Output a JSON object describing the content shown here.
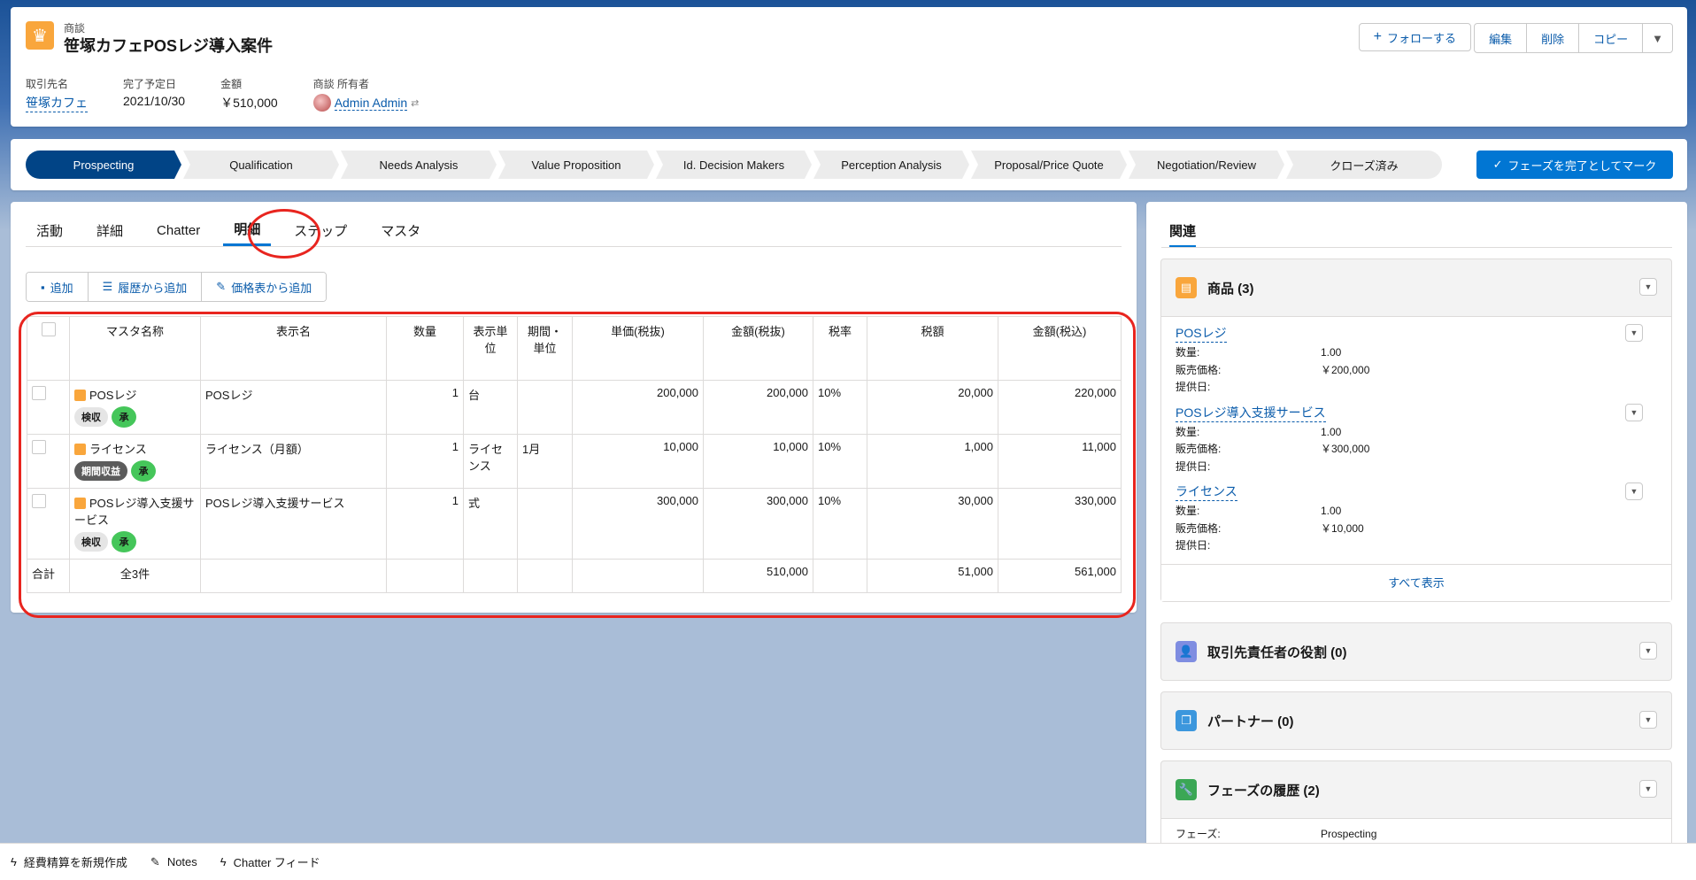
{
  "header": {
    "object_type": "商談",
    "title": "笹塚カフェPOSレジ導入案件",
    "follow_label": "フォローする",
    "actions": [
      "編集",
      "削除",
      "コピー"
    ],
    "fields": [
      {
        "label": "取引先名",
        "value": "笹塚カフェ"
      },
      {
        "label": "完了予定日",
        "value": "2021/10/30"
      },
      {
        "label": "金額",
        "value": "￥510,000"
      },
      {
        "label": "商談 所有者",
        "value": "Admin Admin"
      }
    ]
  },
  "path": {
    "stages": [
      "Prospecting",
      "Qualification",
      "Needs Analysis",
      "Value Proposition",
      "Id. Decision Makers",
      "Perception Analysis",
      "Proposal/Price Quote",
      "Negotiation/Review",
      "クローズ済み"
    ],
    "active_index": 0,
    "mark_button": "フェーズを完了としてマーク"
  },
  "tabs": [
    "活動",
    "詳細",
    "Chatter",
    "明細",
    "ステップ",
    "マスタ"
  ],
  "active_tab": "明細",
  "line_buttons": [
    "追加",
    "履歴から追加",
    "価格表から追加"
  ],
  "table": {
    "headers": [
      "マスタ名称",
      "表示名",
      "数量",
      "表示単位",
      "期間・単位",
      "単価(税抜)",
      "金額(税抜)",
      "税率",
      "税額",
      "金額(税込)"
    ],
    "rows": [
      {
        "master": "POSレジ",
        "badge1": "検収",
        "badge2": "承",
        "display": "POSレジ",
        "qty": "1",
        "unit": "台",
        "period": "",
        "price": "200,000",
        "amount": "200,000",
        "rate": "10%",
        "tax": "20,000",
        "total": "220,000"
      },
      {
        "master": "ライセンス",
        "badge1": "期間収益",
        "badge2": "承",
        "display": "ライセンス（月額）",
        "qty": "1",
        "unit": "ライセンス",
        "period": "1月",
        "price": "10,000",
        "amount": "10,000",
        "rate": "10%",
        "tax": "1,000",
        "total": "11,000"
      },
      {
        "master": "POSレジ導入支援サービス",
        "badge1": "検収",
        "badge2": "承",
        "display": "POSレジ導入支援サービス",
        "qty": "1",
        "unit": "式",
        "period": "",
        "price": "300,000",
        "amount": "300,000",
        "rate": "10%",
        "tax": "30,000",
        "total": "330,000"
      }
    ],
    "footer": {
      "label": "合計",
      "count": "全3件",
      "amount": "510,000",
      "tax": "51,000",
      "total": "561,000"
    }
  },
  "related": {
    "title": "関連",
    "products": {
      "heading": "商品 (3)",
      "items": [
        {
          "name": "POSレジ",
          "qty_label": "数量:",
          "qty": "1.00",
          "price_label": "販売価格:",
          "price": "￥200,000",
          "date_label": "提供日:"
        },
        {
          "name": "POSレジ導入支援サービス",
          "qty_label": "数量:",
          "qty": "1.00",
          "price_label": "販売価格:",
          "price": "￥300,000",
          "date_label": "提供日:"
        },
        {
          "name": "ライセンス",
          "qty_label": "数量:",
          "qty": "1.00",
          "price_label": "販売価格:",
          "price": "￥10,000",
          "date_label": "提供日:"
        }
      ],
      "show_all": "すべて表示"
    },
    "contact_roles": "取引先責任者の役割 (0)",
    "partners": "パートナー (0)",
    "stage_history": {
      "heading": "フェーズの履歴 (2)",
      "field_label": "フェーズ:",
      "field_value": "Prospecting"
    }
  },
  "utility_bar": [
    "経費精算を新規作成",
    "Notes",
    "Chatter フィード"
  ],
  "colors": {
    "brand": "#0176d3",
    "active_stage": "#014486",
    "highlight": "#e8251f",
    "badge_green": "#45c65a"
  }
}
